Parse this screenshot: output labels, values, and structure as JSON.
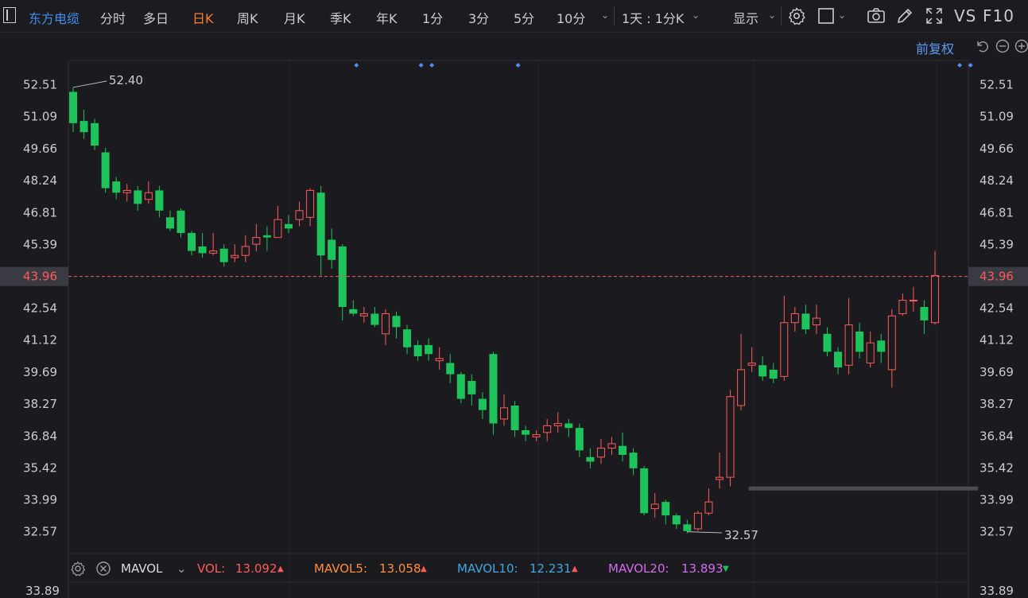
{
  "toolbar": {
    "stock_name": "东方电缆",
    "tabs": [
      "分时",
      "多日",
      "日K",
      "周K",
      "月K",
      "季K",
      "年K",
      "1分",
      "3分",
      "5分",
      "10分"
    ],
    "active_tab": "日K",
    "period_select": "1天 : 1分K",
    "display_select": "显示",
    "vs_text": "VS",
    "f10_text": "F10",
    "icons": [
      "settings-icon",
      "square-icon",
      "camera-icon",
      "pen-icon",
      "expand-icon"
    ]
  },
  "subbar": {
    "adjust_label": "前复权",
    "icons": [
      "undo-icon",
      "zoom-out-icon",
      "zoom-in-icon"
    ]
  },
  "volume_panel": {
    "indicator_name": "MAVOL",
    "vol_label": "VOL:",
    "vol_value": "13.092",
    "mavol5_label": "MAVOL5:",
    "mavol5_value": "13.058",
    "mavol10_label": "MAVOL10:",
    "mavol10_value": "12.231",
    "mavol20_label": "MAVOL20:",
    "mavol20_value": "13.893",
    "axis_top_left": "33.89",
    "axis_top_right": "33.89",
    "colors": {
      "vol": "#ff5a5a",
      "mavol5": "#ff8c3a",
      "mavol10": "#3fa6e0",
      "mavol20": "#d36af0"
    }
  },
  "chart_data": {
    "type": "candlestick",
    "ylim": [
      31.6,
      53.6
    ],
    "yticks": [
      52.51,
      51.09,
      49.66,
      48.24,
      46.81,
      45.39,
      42.54,
      41.12,
      39.69,
      38.27,
      36.84,
      35.42,
      33.99,
      32.57
    ],
    "current_price": 43.96,
    "high_label": "52.40",
    "low_label": "32.57",
    "high_value": 52.4,
    "low_value": 32.57,
    "up_color": "#ff5a5a",
    "down_color": "#1fc35b",
    "event_markers_index": [
      26,
      32,
      33,
      41,
      82,
      83
    ],
    "support_line": {
      "from_index": 63,
      "to_index": 84,
      "value": 34.5
    },
    "candles": [
      [
        52.2,
        50.8,
        52.4,
        50.4
      ],
      [
        50.9,
        50.4,
        51.4,
        50.1
      ],
      [
        50.8,
        49.8,
        51.0,
        49.6
      ],
      [
        49.5,
        47.9,
        49.7,
        47.7
      ],
      [
        48.2,
        47.7,
        48.4,
        47.4
      ],
      [
        47.7,
        47.8,
        48.1,
        47.3
      ],
      [
        47.8,
        47.2,
        48.0,
        46.9
      ],
      [
        47.4,
        47.7,
        48.2,
        47.2
      ],
      [
        47.8,
        46.9,
        48.0,
        46.6
      ],
      [
        46.6,
        46.1,
        46.9,
        46.0
      ],
      [
        46.9,
        45.9,
        47.0,
        45.7
      ],
      [
        45.9,
        45.1,
        46.0,
        44.9
      ],
      [
        45.3,
        45.0,
        45.9,
        44.8
      ],
      [
        45.0,
        45.1,
        45.9,
        44.9
      ],
      [
        45.2,
        44.6,
        45.4,
        44.4
      ],
      [
        44.8,
        44.9,
        45.4,
        44.6
      ],
      [
        44.9,
        45.3,
        45.8,
        44.6
      ],
      [
        45.4,
        45.7,
        46.3,
        45.1
      ],
      [
        45.8,
        45.7,
        46.2,
        45.1
      ],
      [
        45.7,
        46.5,
        47.1,
        45.8
      ],
      [
        46.3,
        46.1,
        46.7,
        45.9
      ],
      [
        46.5,
        46.9,
        47.3,
        46.2
      ],
      [
        46.6,
        47.8,
        47.9,
        46.2
      ],
      [
        47.7,
        44.9,
        48.0,
        44.0
      ],
      [
        45.6,
        44.7,
        46.1,
        44.3
      ],
      [
        45.3,
        42.6,
        45.4,
        42.0
      ],
      [
        42.5,
        42.3,
        42.9,
        42.2
      ],
      [
        42.2,
        42.3,
        42.6,
        41.9
      ],
      [
        42.3,
        41.8,
        42.6,
        41.7
      ],
      [
        41.4,
        42.3,
        42.5,
        40.9
      ],
      [
        42.2,
        41.7,
        42.4,
        41.2
      ],
      [
        41.6,
        40.8,
        41.8,
        40.5
      ],
      [
        40.9,
        40.4,
        41.1,
        40.2
      ],
      [
        40.9,
        40.5,
        41.2,
        40.2
      ],
      [
        40.2,
        40.3,
        40.8,
        39.8
      ],
      [
        40.1,
        39.6,
        40.5,
        39.2
      ],
      [
        39.6,
        38.5,
        39.7,
        38.3
      ],
      [
        39.3,
        38.7,
        39.6,
        38.2
      ],
      [
        38.5,
        38.0,
        38.8,
        37.6
      ],
      [
        40.5,
        37.4,
        40.6,
        36.9
      ],
      [
        37.6,
        38.1,
        38.7,
        37.3
      ],
      [
        38.2,
        37.1,
        38.4,
        36.8
      ],
      [
        37.1,
        36.9,
        37.3,
        36.6
      ],
      [
        36.8,
        36.9,
        37.1,
        36.6
      ],
      [
        37.0,
        37.3,
        37.6,
        36.6
      ],
      [
        37.3,
        37.4,
        37.9,
        37.0
      ],
      [
        37.4,
        37.2,
        37.6,
        36.8
      ],
      [
        37.2,
        36.2,
        37.4,
        35.9
      ],
      [
        35.9,
        35.7,
        36.3,
        35.4
      ],
      [
        35.9,
        36.3,
        36.7,
        35.6
      ],
      [
        36.3,
        36.5,
        36.8,
        36.0
      ],
      [
        36.4,
        36.0,
        37.0,
        35.7
      ],
      [
        36.1,
        35.4,
        36.3,
        35.1
      ],
      [
        35.4,
        33.4,
        35.5,
        33.3
      ],
      [
        33.6,
        33.8,
        34.3,
        33.2
      ],
      [
        33.9,
        33.3,
        34.0,
        32.9
      ],
      [
        33.3,
        32.9,
        33.4,
        32.7
      ],
      [
        32.9,
        32.6,
        33.1,
        32.5
      ],
      [
        32.7,
        33.4,
        33.5,
        32.6
      ],
      [
        33.4,
        33.9,
        34.5,
        33.3
      ],
      [
        34.9,
        35.0,
        36.1,
        34.5
      ],
      [
        35.0,
        38.6,
        38.9,
        34.6
      ],
      [
        38.2,
        39.8,
        41.4,
        38.0
      ],
      [
        40.0,
        40.1,
        40.8,
        39.7
      ],
      [
        40.0,
        39.5,
        40.4,
        39.3
      ],
      [
        39.8,
        39.4,
        40.1,
        39.2
      ],
      [
        39.5,
        41.9,
        43.1,
        39.3
      ],
      [
        41.9,
        42.3,
        42.6,
        41.5
      ],
      [
        42.3,
        41.6,
        42.7,
        41.4
      ],
      [
        41.8,
        42.1,
        42.7,
        41.4
      ],
      [
        41.4,
        40.6,
        41.7,
        40.4
      ],
      [
        40.6,
        39.9,
        40.8,
        39.6
      ],
      [
        40.0,
        41.8,
        43.0,
        39.6
      ],
      [
        41.5,
        40.6,
        41.9,
        40.3
      ],
      [
        40.1,
        41.0,
        41.5,
        39.9
      ],
      [
        41.1,
        40.6,
        41.4,
        40.1
      ],
      [
        39.8,
        42.2,
        42.5,
        39.0
      ],
      [
        42.3,
        42.9,
        43.2,
        42.2
      ],
      [
        42.9,
        42.9,
        43.5,
        42.4
      ],
      [
        42.6,
        42.0,
        42.9,
        41.4
      ],
      [
        41.9,
        44.0,
        45.1,
        41.8
      ]
    ]
  }
}
